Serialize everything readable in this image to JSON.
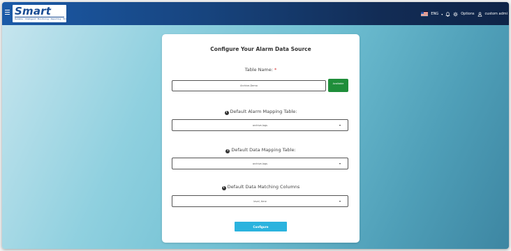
{
  "topbar": {
    "logo_text": "Smart",
    "logo_tagline": "Reliable · Intelligent · Monitoring · Reporting · Tool",
    "language": "ENG",
    "options_label": "Options",
    "user_label": "custom admi"
  },
  "card": {
    "title": "Configure Your Alarm Data Source",
    "table_name_label": "Table Name:",
    "required_mark": "*",
    "table_name_value": "Archive-Demo",
    "available_label": "Available",
    "alarm_mapping_label": "Default Alarm Mapping Table:",
    "alarm_mapping_value": "archive-logs",
    "data_mapping_label": "Default Data Mapping Table:",
    "data_mapping_value": "archive-logs",
    "matching_columns_label": "Default Data Matching Columns",
    "matching_columns_value": "level, time",
    "configure_label": "Configure"
  },
  "colors": {
    "topbar": "#17447e",
    "available_button": "#1f8e3a",
    "configure_button": "#2bb3de",
    "required": "#d32f2f"
  },
  "icons": [
    "menu-icon",
    "bell-icon",
    "gear-icon",
    "user-icon",
    "info-icon",
    "chevron-down-icon"
  ]
}
